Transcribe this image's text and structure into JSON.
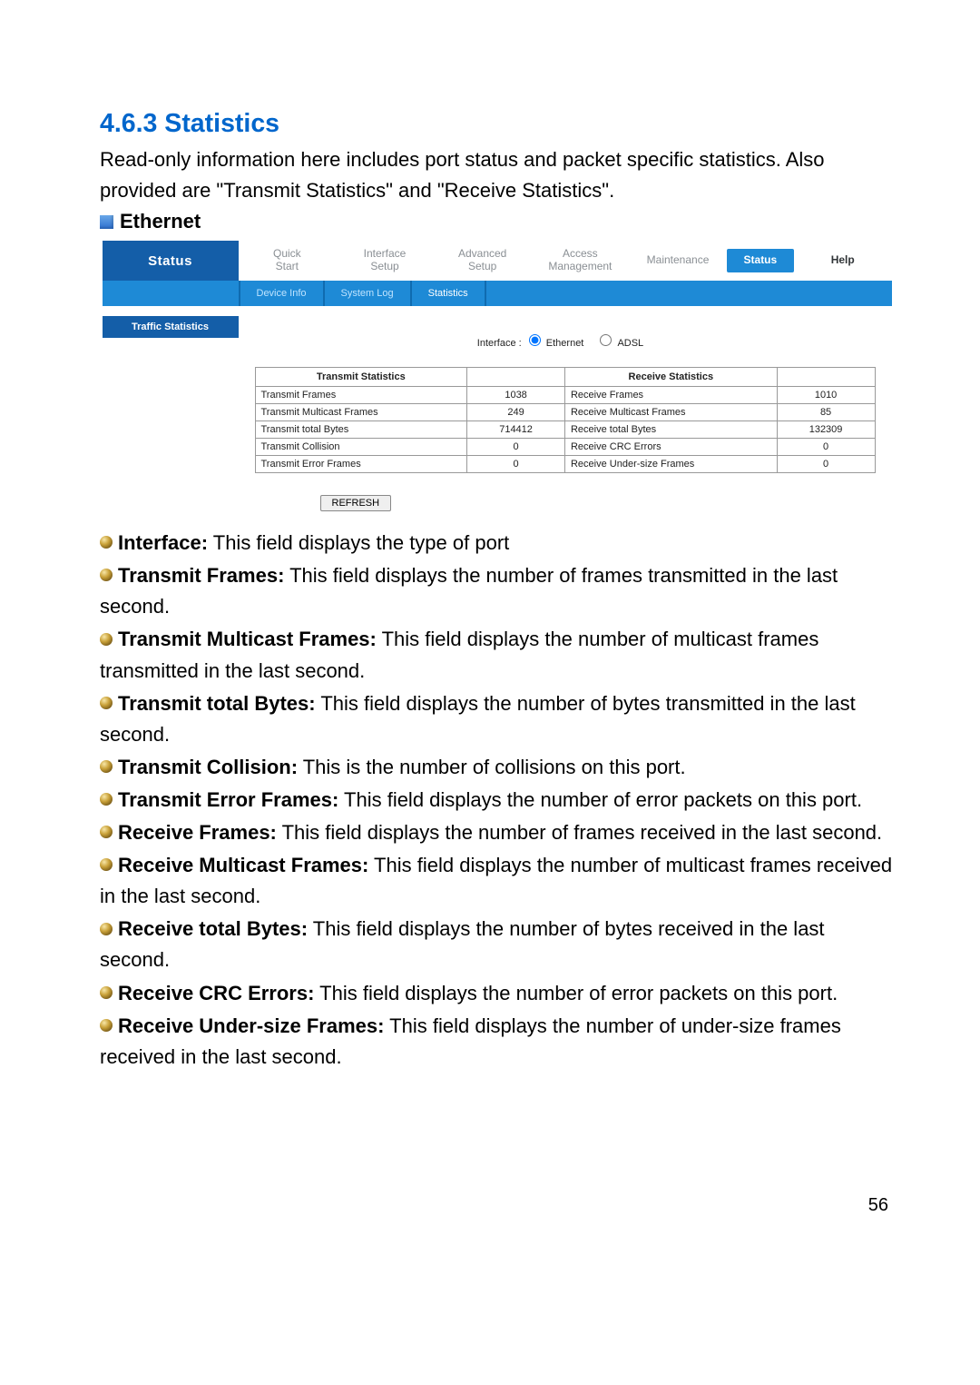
{
  "section": {
    "number_title": "4.6.3 Statistics",
    "intro": "Read-only information here includes port status and packet specific statistics. Also provided are \"Transmit Statistics\" and \"Receive Statistics\".",
    "ethernet_label": "Ethernet"
  },
  "router": {
    "status_label": "Status",
    "tabs": {
      "quick_start": "Quick\nStart",
      "interface_setup": "Interface\nSetup",
      "advanced_setup": "Advanced\nSetup",
      "access_mgmt": "Access\nManagement",
      "maintenance": "Maintenance",
      "status": "Status",
      "help": "Help"
    },
    "subtabs": {
      "device_info": "Device Info",
      "system_log": "System Log",
      "statistics": "Statistics"
    },
    "side_header": "Traffic Statistics",
    "iface": {
      "label": "Interface :",
      "opt_eth": "Ethernet",
      "opt_adsl": "ADSL"
    },
    "table": {
      "tx_header": "Transmit Statistics",
      "rx_header": "Receive Statistics",
      "rows": [
        {
          "tx_label": "Transmit Frames",
          "tx_val": "1038",
          "rx_label": "Receive Frames",
          "rx_val": "1010"
        },
        {
          "tx_label": "Transmit Multicast Frames",
          "tx_val": "249",
          "rx_label": "Receive Multicast Frames",
          "rx_val": "85"
        },
        {
          "tx_label": "Transmit total Bytes",
          "tx_val": "714412",
          "rx_label": "Receive total Bytes",
          "rx_val": "132309"
        },
        {
          "tx_label": "Transmit Collision",
          "tx_val": "0",
          "rx_label": "Receive CRC Errors",
          "rx_val": "0"
        },
        {
          "tx_label": "Transmit Error Frames",
          "tx_val": "0",
          "rx_label": "Receive Under-size Frames",
          "rx_val": "0"
        }
      ]
    },
    "refresh_label": "REFRESH"
  },
  "explain": [
    {
      "term": "Interface:",
      "desc": " This field displays the type of port"
    },
    {
      "term": "Transmit Frames:",
      "desc": " This field displays the number of frames transmitted in the last second."
    },
    {
      "term": "Transmit Multicast Frames:",
      "desc": " This field displays the number of multicast frames transmitted in the last second."
    },
    {
      "term": "Transmit total Bytes:",
      "desc": " This field displays the number of bytes transmitted in the last second."
    },
    {
      "term": "Transmit Collision:",
      "desc": " This is the number of collisions on this port."
    },
    {
      "term": "Transmit Error Frames:",
      "desc": " This field displays the number of error packets on this port."
    },
    {
      "term": "Receive Frames:",
      "desc": " This field displays the number of frames received in the last second."
    },
    {
      "term": "Receive Multicast Frames:",
      "desc": " This field displays the number of multicast frames received in the last second."
    },
    {
      "term": "Receive total Bytes:",
      "desc": " This field displays the number of bytes received in the last second."
    },
    {
      "term": "Receive CRC Errors:",
      "desc": " This field displays the number of error packets on this port."
    },
    {
      "term": "Receive Under-size Frames:",
      "desc": " This field displays the number of under-size frames received in the last second."
    }
  ],
  "page_number": "56"
}
